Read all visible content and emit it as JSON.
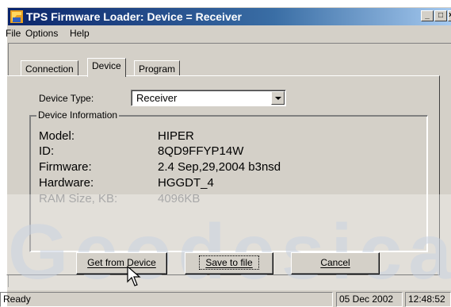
{
  "window": {
    "title": "TPS Firmware Loader:  Device = Receiver",
    "controls": {
      "minimize": "_",
      "maximize": "□",
      "close": "×"
    }
  },
  "menu": {
    "items": [
      "File",
      "Options",
      "Help"
    ]
  },
  "tabs": [
    "Connection",
    "Device",
    "Program"
  ],
  "active_tab": "Device",
  "device": {
    "type_label": "Device Type:",
    "type_value": "Receiver"
  },
  "info": {
    "caption": "Device Information",
    "rows": [
      {
        "label": "Model:",
        "value": "HIPER"
      },
      {
        "label": "ID:",
        "value": "8QD9FFYP14W"
      },
      {
        "label": "Firmware:",
        "value": "2.4 Sep,29,2004 b3nsd"
      },
      {
        "label": "Hardware:",
        "value": "HGGDT_4"
      },
      {
        "label": "RAM Size, KB:",
        "value": "4096KB"
      }
    ]
  },
  "buttons": {
    "get": "Get from Device",
    "save": "Save to file",
    "cancel": "Cancel"
  },
  "watermark": "Geodesica",
  "status": {
    "text": "Ready",
    "date": "05 Dec 2002",
    "time": "12:48:52"
  },
  "colors": {
    "titlebar": "#0a246a",
    "face": "#d4d0c8",
    "shadow": "#808080"
  }
}
